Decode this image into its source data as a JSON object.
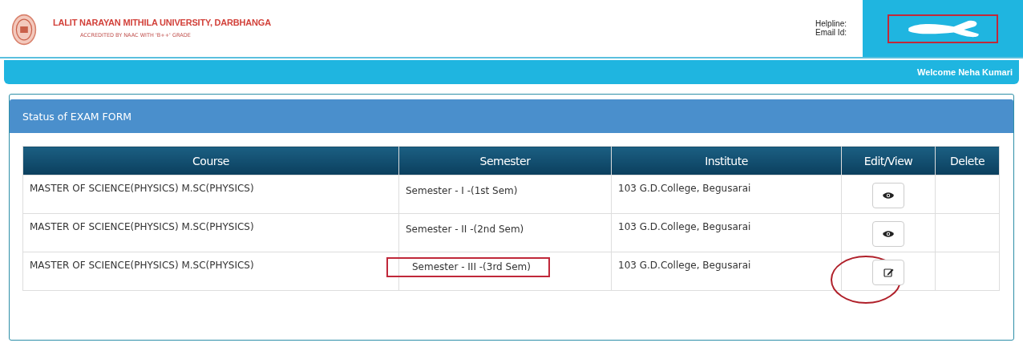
{
  "header": {
    "university": "LALIT NARAYAN MITHILA UNIVERSITY, DARBHANGA",
    "accreditation": "ACCREDITED BY NAAC WITH 'B++' GRADE",
    "contact_labels": [
      "Helpline:",
      "Email Id:"
    ]
  },
  "welcome": "Welcome Neha Kumari",
  "panel": {
    "title": "Status of EXAM FORM"
  },
  "table": {
    "columns": [
      "Course",
      "Semester",
      "Institute",
      "Edit/View",
      "Delete"
    ],
    "rows": [
      {
        "course": "MASTER OF SCIENCE(PHYSICS) M.SC(PHYSICS)",
        "semester": "Semester - I -(1st Sem)",
        "institute": "103 G.D.College, Begusarai",
        "action": {
          "kind": "view"
        },
        "semester_marked": false,
        "action_marked": false
      },
      {
        "course": "MASTER OF SCIENCE(PHYSICS) M.SC(PHYSICS)",
        "semester": "Semester - II -(2nd Sem)",
        "institute": "103 G.D.College, Begusarai",
        "action": {
          "kind": "view"
        },
        "semester_marked": false,
        "action_marked": false
      },
      {
        "course": "MASTER OF SCIENCE(PHYSICS) M.SC(PHYSICS)",
        "semester": "Semester - III -(3rd Sem)",
        "institute": "103 G.D.College, Begusarai",
        "action": {
          "kind": "edit"
        },
        "semester_marked": true,
        "action_marked": true
      }
    ]
  }
}
